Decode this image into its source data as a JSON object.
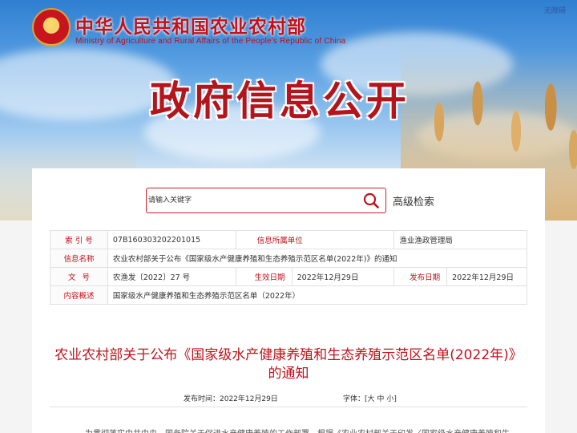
{
  "header": {
    "logo_cn": "中华人民共和国农业农村部",
    "logo_en": "Ministry of Agriculture and Rural Affairs of the People's Republic of China",
    "accessibility": "无障碍",
    "banner_title": "政府信息公开"
  },
  "search": {
    "placeholder": "请输入关键字",
    "advanced_label": "高级检索"
  },
  "info": {
    "index_label": "索 引 号",
    "index_value": "07B160303202201015",
    "org_label": "信息所属单位",
    "org_value": "渔业渔政管理局",
    "name_label": "信息名称",
    "name_value": "农业农村部关于公布《国家级水产健康养殖和生态养殖示范区名单(2022年)》的通知",
    "docno_label": "文号",
    "docno_value": "农渔发〔2022〕27 号",
    "gen_date_label": "生效日期",
    "gen_date_value": "2022年12月29日",
    "pub_date_label": "发布日期",
    "pub_date_value": "2022年12月29日",
    "summary_label": "内容概述",
    "summary_value": "国家级水产健康养殖和生态养殖示范区名单（2022年）"
  },
  "article": {
    "title": "农业农村部关于公布《国家级水产健康养殖和生态养殖示范区名单(2022年)》的通知",
    "pub_date": "发布时间：2022年12月29日",
    "font_label": "字体：",
    "font_open": "[",
    "font_large": "大",
    "font_medium": "中",
    "font_small": "小",
    "font_close": "]",
    "body_start": "为贯彻落实中共中央、国务院关于促进水产健康养殖的工作部署，根据《农业农村部关于印发〈国家级水产健康养殖和生态"
  }
}
